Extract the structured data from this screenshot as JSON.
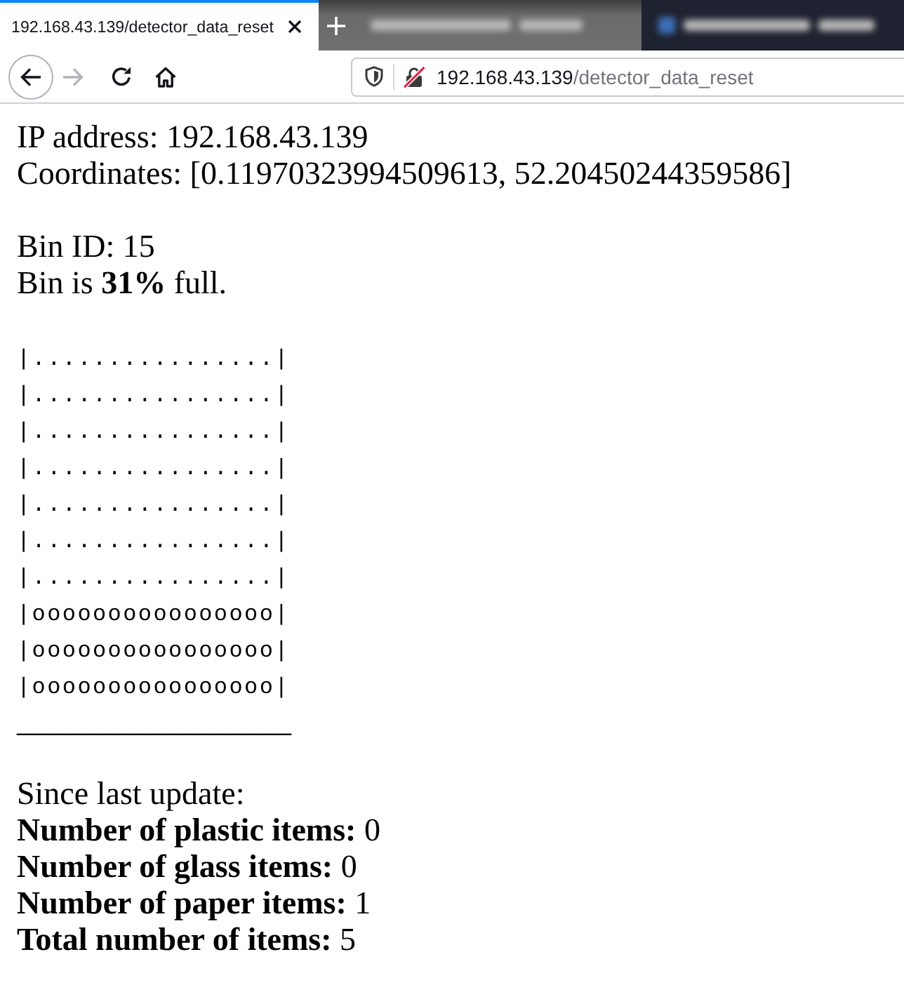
{
  "browser": {
    "tabs": [
      {
        "title": "192.168.43.139/detector_data_reset",
        "selected": true
      },
      {
        "selected": false
      },
      {
        "selected": false
      }
    ],
    "nav_buttons": [
      {
        "kind": "back",
        "disabled": false
      },
      {
        "kind": "forward",
        "disabled": true
      },
      {
        "kind": "reload",
        "disabled": false
      },
      {
        "kind": "home",
        "disabled": false
      }
    ],
    "address_bar": {
      "host": "192.168.43.139",
      "path": "/detector_data_reset",
      "secure": false
    }
  },
  "report": {
    "device_lines": [
      "IP address: 192.168.43.139",
      "Coordinates: [0.11970323994509613, 52.20450244359586]"
    ],
    "bin_lines": [
      "Bin ID: 15",
      "Bin is **31%** full."
    ],
    "bin_rows": [
      "|................|",
      "|................|",
      "|................|",
      "|................|",
      "|................|",
      "|................|",
      "|................|",
      "|oooooooooooooooo|",
      "|oooooooooooooooo|",
      "|oooooooooooooooo|"
    ],
    "bin_base": "_________________",
    "stats_heading": "Since last update:",
    "stats": [
      "**Number of plastic items:** 0",
      "**Number of glass items:** 0",
      "**Number of paper items:** 1",
      "**Total number of items:** 5"
    ]
  }
}
